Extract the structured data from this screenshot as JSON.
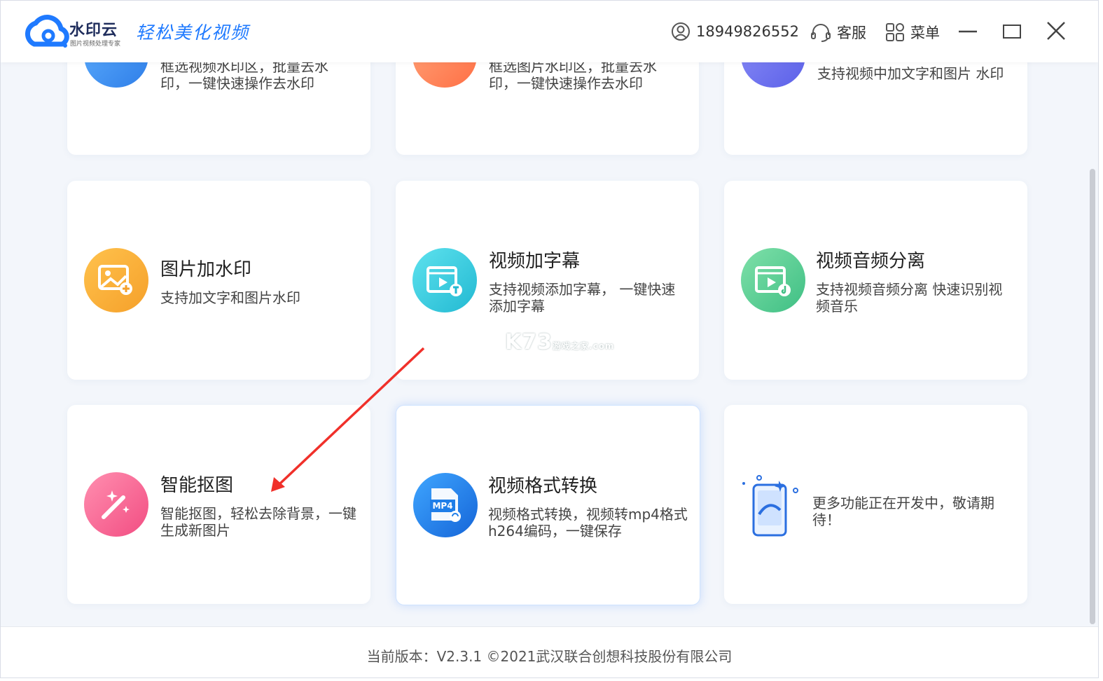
{
  "header": {
    "brand_name": "水印云",
    "brand_sub": "图片视频处理专家",
    "slogan": "轻松美化视频",
    "user_phone": "18949826552",
    "service_label": "客服",
    "menu_label": "菜单"
  },
  "cards": [
    {
      "desc": "框选视频水印区，批量去水印，一键快速操作去水印",
      "icon": "video-remove-watermark-icon",
      "color": "#3d8bf0"
    },
    {
      "desc": "框选图片水印区，批量去水印，一键快速操作去水印",
      "icon": "image-remove-watermark-icon",
      "color": "#ff7f50"
    },
    {
      "desc": "支持视频中加文字和图片 水印",
      "icon": "video-add-watermark-icon",
      "color": "#6f72f0"
    },
    {
      "title": "图片加水印",
      "desc": "支持加文字和图片水印",
      "icon": "image-add-watermark-icon",
      "color": "#f7a531"
    },
    {
      "title": "视频加字幕",
      "desc": "支持视频添加字幕， 一键快速添加字幕",
      "icon": "video-subtitle-icon",
      "color": "#2ec4d8"
    },
    {
      "title": "视频音频分离",
      "desc": "支持视频音频分离 快速识别视频音乐",
      "icon": "audio-separate-icon",
      "color": "#4fcb8f"
    },
    {
      "title": "智能抠图",
      "desc": "智能抠图，轻松去除背景，一键生成新图片",
      "icon": "magic-wand-icon",
      "color": "#f55d8f"
    },
    {
      "title": "视频格式转换",
      "desc": "视频格式转换，视频转mp4格式h264编码，一键保存",
      "icon": "mp4-convert-icon",
      "color": "#1f7ee8",
      "mp4": "MP4"
    },
    {
      "desc": "更多功能正在开发中，敬请期待！",
      "icon": "coming-soon-phone-icon"
    }
  ],
  "watermark": {
    "main": "K73",
    "sub": "游戏之家",
    "dom": ".com"
  },
  "footer": {
    "text": "当前版本：V2.3.1 ©2021武汉联合创想科技股份有限公司"
  }
}
